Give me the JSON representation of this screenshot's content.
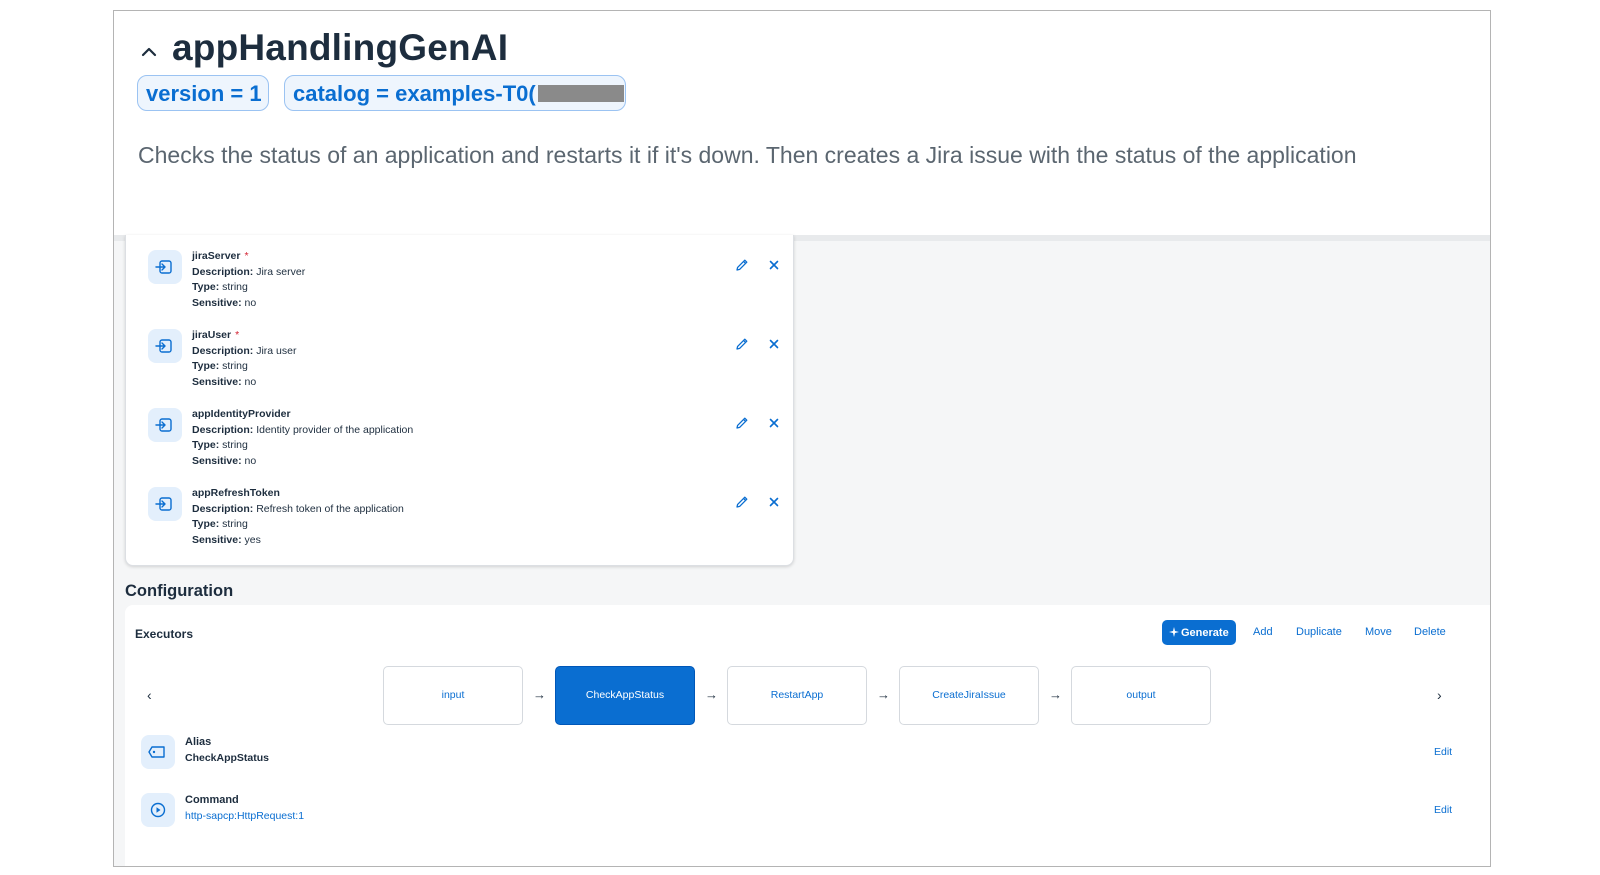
{
  "header": {
    "title": "appHandlingGenAI",
    "tags": [
      {
        "label": "version = 1"
      },
      {
        "label": "catalog = examples-T0("
      }
    ],
    "description": "Checks the status of an application and restarts it if it's down. Then creates a Jira issue with the status of the application"
  },
  "inputs": {
    "field_labels": {
      "description": "Description:",
      "type": "Type:",
      "sensitive": "Sensitive:"
    },
    "required_mark": "*",
    "items": [
      {
        "name": "jiraServer",
        "required": true,
        "description": "Jira server",
        "type": "string",
        "sensitive": "no",
        "icon": "input-parameter-icon"
      },
      {
        "name": "jiraUser",
        "required": true,
        "description": "Jira user",
        "type": "string",
        "sensitive": "no",
        "icon": "input-parameter-icon"
      },
      {
        "name": "appIdentityProvider",
        "required": false,
        "description": "Identity provider of the application",
        "type": "string",
        "sensitive": "no",
        "icon": "input-parameter-icon"
      },
      {
        "name": "appRefreshToken",
        "required": false,
        "description": "Refresh token of the application",
        "type": "string",
        "sensitive": "yes",
        "icon": "input-parameter-icon"
      }
    ]
  },
  "configuration": {
    "title": "Configuration",
    "executors_label": "Executors",
    "toolbar": {
      "generate": "Generate",
      "add": "Add",
      "duplicate": "Duplicate",
      "move": "Move",
      "delete": "Delete"
    },
    "nav": {
      "prev": "‹",
      "next": "›"
    },
    "steps": [
      {
        "label": "input",
        "active": false
      },
      {
        "label": "CheckAppStatus",
        "active": true
      },
      {
        "label": "RestartApp",
        "active": false
      },
      {
        "label": "CreateJiraIssue",
        "active": false
      },
      {
        "label": "output",
        "active": false
      }
    ],
    "arrow": "→",
    "details": [
      {
        "label": "Alias",
        "value": "CheckAppStatus",
        "edit": "Edit",
        "icon": "tag-icon"
      },
      {
        "label": "Command",
        "value": "http-sapcp:HttpRequest:1",
        "edit": "Edit",
        "icon": "play-icon"
      }
    ]
  },
  "colors": {
    "accent": "#0a6ed1",
    "title": "#1d2d3e",
    "description": "#5b6670",
    "required": "#d32030",
    "canvas": "#f5f6f7",
    "icon_bg": "#e3effc"
  }
}
